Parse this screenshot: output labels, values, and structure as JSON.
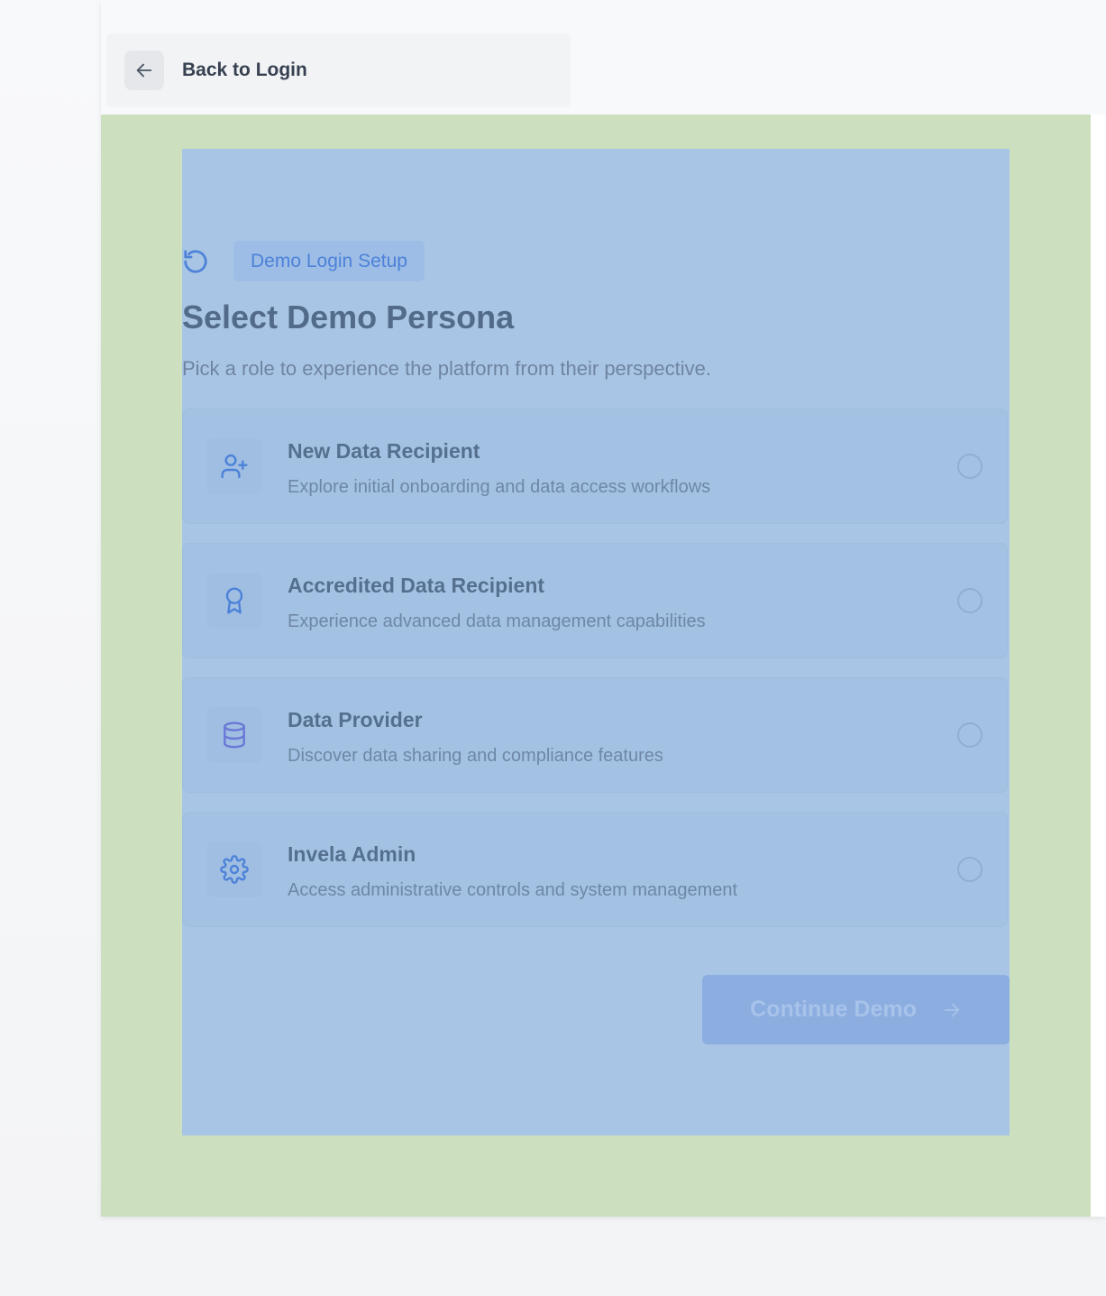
{
  "back": {
    "label": "Back to Login",
    "icon": "arrow-left-icon"
  },
  "badge": {
    "label": "Demo Login Setup",
    "icon": "refresh-icon"
  },
  "heading": {
    "title": "Select Demo Persona",
    "subtitle": "Pick a role to experience the platform from their perspective."
  },
  "personas": [
    {
      "name": "New Data Recipient",
      "description": "Explore initial onboarding and data access workflows",
      "icon": "user-plus-icon"
    },
    {
      "name": "Accredited Data Recipient",
      "description": "Experience advanced data management capabilities",
      "icon": "award-icon"
    },
    {
      "name": "Data Provider",
      "description": "Discover data sharing and compliance features",
      "icon": "database-icon"
    },
    {
      "name": "Invela Admin",
      "description": "Access administrative controls and system management",
      "icon": "gear-icon"
    }
  ],
  "continue": {
    "label": "Continue Demo",
    "icon": "arrow-right-icon"
  },
  "colors": {
    "page_background": "#f8f9fb",
    "green_overlay": "#ccdfbe",
    "blue_overlay": "#a8c5e5",
    "accent": "#4d82d8",
    "button": "#8cade0"
  }
}
